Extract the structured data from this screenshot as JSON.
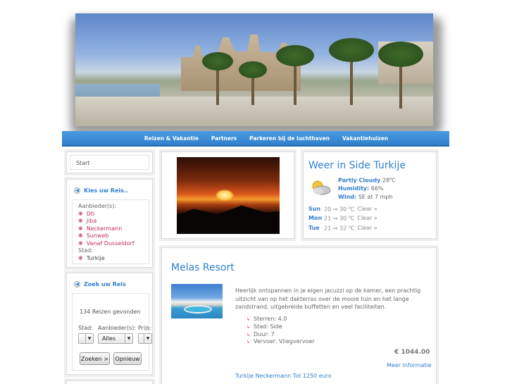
{
  "nav": {
    "items": [
      "Reizen & Vakantie",
      "Partners",
      "Parkeren bij de luchthaven",
      "Vakantiehuizen"
    ]
  },
  "sidebar": {
    "start_label": "Start",
    "kies": {
      "title": "Kies uw Reis..",
      "aanbieder_label": "Aanbieder(s):",
      "aanbieders": [
        "Dti",
        "Jiba",
        "Neckermann",
        "Sunweb",
        "Vanaf Dusseldorf"
      ],
      "stad_label": "Stad:",
      "steden": [
        "Turkije"
      ]
    },
    "zoek": {
      "title": "Zoek uw Reis",
      "count_text": "134 Reizen gevonden",
      "stad_label": "Stad:",
      "aanbieder_label": "Aanbieder(s):",
      "prijs_label": "Prijs:",
      "aanbieder_value": "Alles",
      "zoeken_button": "Zoeken >",
      "opnieuw_button": "Opnieuw"
    }
  },
  "weather": {
    "title": "Weer in Side Turkije",
    "condition": "Partly Cloudy",
    "temp": "28",
    "temp_unit": "C",
    "humidity_label": "Humidity:",
    "humidity": "66%",
    "wind_label": "Wind:",
    "wind": "SE at 7 mph",
    "forecast": [
      {
        "day": "Sun",
        "low": "20",
        "high": "30",
        "cond": "Clear »"
      },
      {
        "day": "Mon",
        "low": "21",
        "high": "30",
        "cond": "Clear »"
      },
      {
        "day": "Tue",
        "low": "21",
        "high": "32",
        "cond": "Clear »"
      }
    ]
  },
  "resort": {
    "title": "Melas Resort",
    "description": "Heerlijk ontspannen in je eigen jacuzzi op de kamer, een prachtig uitzicht van op het dakterras over de mooie tuin en het lange zandstrand, uitgebreide buffetten en veel faciliteiten.",
    "specs": [
      "Sterren: 4.0",
      "Stad: Side",
      "Duur: 7",
      "Vervoer: Vliegvervoer"
    ],
    "price": "€ 1044.00",
    "more_label": "Meer informatie",
    "next_link": "Turkije Neckermann Tot 1250 euro"
  },
  "colors": {
    "accent": "#2f7fcd",
    "link_red": "#c0305a"
  }
}
